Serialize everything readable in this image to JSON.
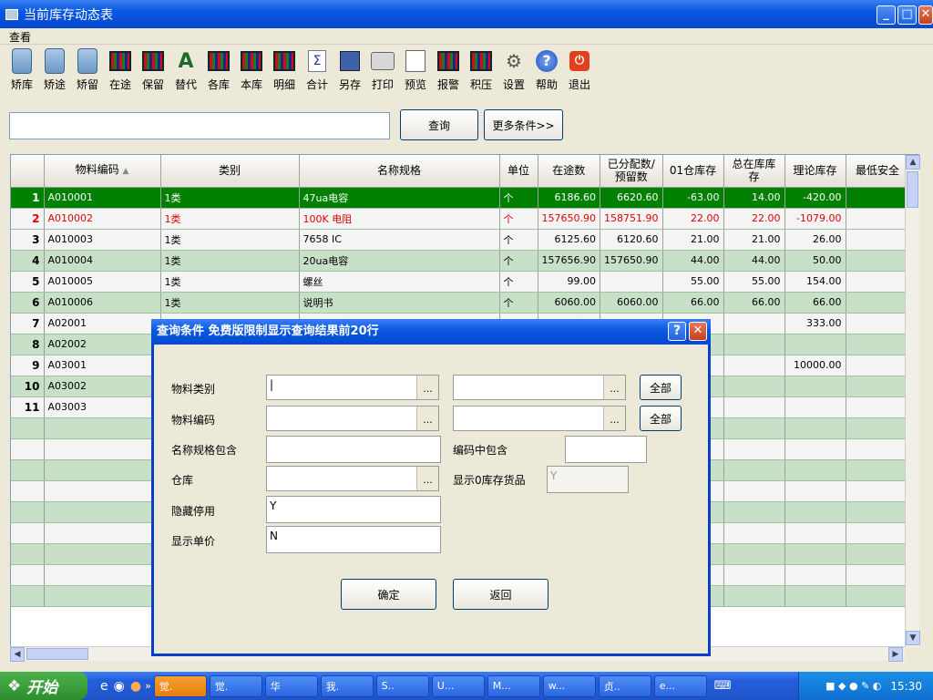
{
  "window": {
    "title": "当前库存动态表"
  },
  "menu": {
    "items": [
      {
        "label": "查看"
      }
    ]
  },
  "toolbar": {
    "buttons": [
      {
        "label": "矫库",
        "icon": "calculator-icon"
      },
      {
        "label": "矫途",
        "icon": "calculator-icon"
      },
      {
        "label": "矫留",
        "icon": "calculator-icon"
      },
      {
        "label": "在途",
        "icon": "grid-icon"
      },
      {
        "label": "保留",
        "icon": "grid-icon"
      },
      {
        "label": "替代",
        "icon": "replace-icon"
      },
      {
        "label": "各库",
        "icon": "grid-icon"
      },
      {
        "label": "本库",
        "icon": "grid-icon"
      },
      {
        "label": "明细",
        "icon": "grid-icon"
      },
      {
        "label": "合计",
        "icon": "sigma-icon"
      },
      {
        "label": "另存",
        "icon": "save-icon"
      },
      {
        "label": "打印",
        "icon": "printer-icon"
      },
      {
        "label": "预览",
        "icon": "preview-icon"
      },
      {
        "label": "报警",
        "icon": "grid-icon"
      },
      {
        "label": "积压",
        "icon": "grid-icon"
      },
      {
        "label": "设置",
        "icon": "settings-icon"
      },
      {
        "label": "帮助",
        "icon": "help-icon"
      },
      {
        "label": "退出",
        "icon": "exit-icon"
      }
    ]
  },
  "search": {
    "value": "",
    "query_label": "查询",
    "more_label": "更多条件>>"
  },
  "grid": {
    "columns": [
      "物料编码",
      "类别",
      "名称规格",
      "单位",
      "在途数",
      "已分配数/预留数",
      "01仓库存",
      "总在库库存",
      "理论库存",
      "最低安全"
    ],
    "rows": [
      {
        "no": "1",
        "cells": [
          "A010001",
          "1类",
          "47ua电容",
          "个",
          "6186.60",
          "6620.60",
          "-63.00",
          "14.00",
          "-420.00",
          ""
        ]
      },
      {
        "no": "2",
        "cells": [
          "A010002",
          "1类",
          "100K 电阻",
          "个",
          "157650.90",
          "158751.90",
          "22.00",
          "22.00",
          "-1079.00",
          ""
        ]
      },
      {
        "no": "3",
        "cells": [
          "A010003",
          "1类",
          "7658 IC",
          "个",
          "6125.60",
          "6120.60",
          "21.00",
          "21.00",
          "26.00",
          ""
        ]
      },
      {
        "no": "4",
        "cells": [
          "A010004",
          "1类",
          "20ua电容",
          "个",
          "157656.90",
          "157650.90",
          "44.00",
          "44.00",
          "50.00",
          ""
        ]
      },
      {
        "no": "5",
        "cells": [
          "A010005",
          "1类",
          "螺丝",
          "个",
          "99.00",
          "",
          "55.00",
          "55.00",
          "154.00",
          ""
        ]
      },
      {
        "no": "6",
        "cells": [
          "A010006",
          "1类",
          "说明书",
          "个",
          "6060.00",
          "6060.00",
          "66.00",
          "66.00",
          "66.00",
          ""
        ]
      },
      {
        "no": "7",
        "cells": [
          "A02001",
          "",
          "",
          "",
          "",
          "",
          "",
          "",
          "333.00",
          ""
        ]
      },
      {
        "no": "8",
        "cells": [
          "A02002",
          "",
          "",
          "",
          "",
          "",
          "",
          "",
          "",
          ""
        ]
      },
      {
        "no": "9",
        "cells": [
          "A03001",
          "",
          "",
          "",
          "",
          "",
          "",
          "",
          "10000.00",
          ""
        ]
      },
      {
        "no": "10",
        "cells": [
          "A03002",
          "",
          "",
          "",
          "",
          "",
          "",
          "",
          "",
          ""
        ]
      },
      {
        "no": "11",
        "cells": [
          "A03003",
          "",
          "",
          "",
          "",
          "",
          "",
          "",
          "",
          ""
        ]
      }
    ]
  },
  "dialog": {
    "title": "查询条件  免费版限制显示查询结果前20行",
    "material_category_label": "物料类别",
    "material_code_label": "物料编码",
    "name_contains_label": "名称规格包含",
    "code_contains_label": "编码中包含",
    "warehouse_label": "仓库",
    "show_zero_label": "显示0库存货品",
    "hide_disabled_label": "隐藏停用",
    "show_price_label": "显示单价",
    "all_label": "全部",
    "ellipsis": "...",
    "show_zero_value": "Y",
    "hide_disabled_value": "Y",
    "show_price_value": "N",
    "ok_label": "确定",
    "back_label": "返回",
    "help_glyph": "?",
    "close_glyph": "✕"
  },
  "taskbar": {
    "start_label": "开始",
    "tasks": [
      "觉.",
      "觉.",
      "华",
      "我.",
      "S..",
      "U...",
      "M...",
      "w...",
      "贞..",
      "e..."
    ],
    "clock": "15:30"
  }
}
